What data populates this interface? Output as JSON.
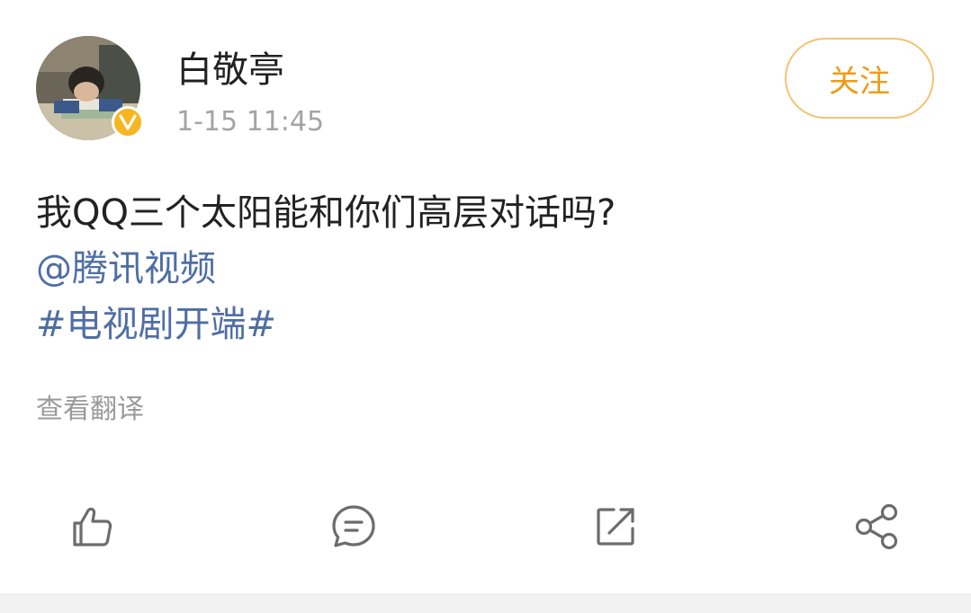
{
  "post": {
    "author": {
      "name": "白敬亭",
      "avatar_icon": "user-avatar-photo",
      "verified_icon": "verified-v-badge-icon",
      "verified_color": "#f5b621"
    },
    "timestamp": "1-15 11:45",
    "follow_label": "关注",
    "text": "我QQ三个太阳能和你们高层对话吗?",
    "mention": "@腾讯视频",
    "hashtag": "#电视剧开端#",
    "translate_label": "查看翻译"
  },
  "actions": [
    {
      "icon": "like-thumb-icon"
    },
    {
      "icon": "comment-bubble-icon"
    },
    {
      "icon": "repost-icon"
    },
    {
      "icon": "share-icon"
    }
  ],
  "colors": {
    "link": "#4f6ea4",
    "follow": "#ec9c1a",
    "follow_border": "#f3c472",
    "meta_text": "#a4a4a4"
  }
}
